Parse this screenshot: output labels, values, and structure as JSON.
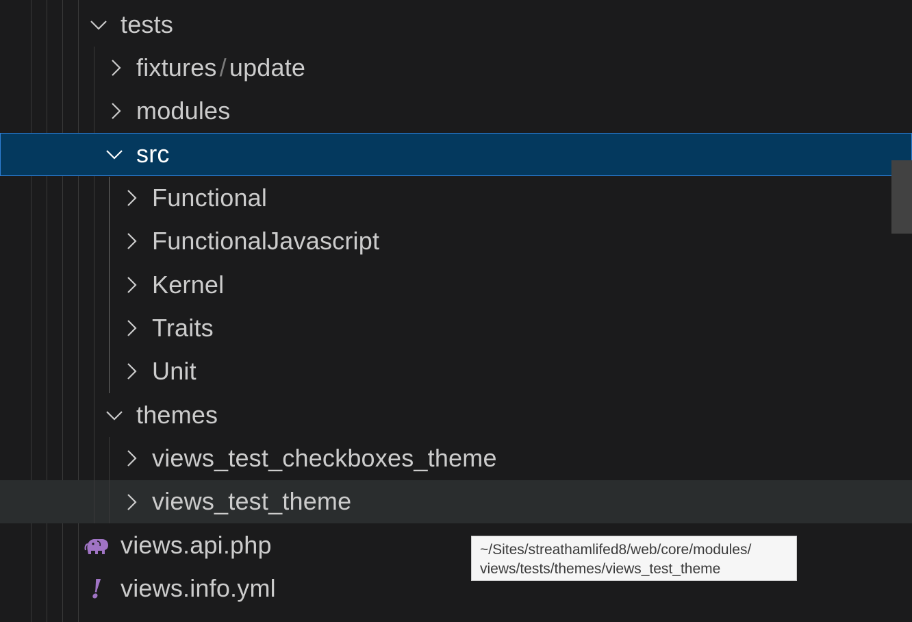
{
  "explorer": {
    "rows": [
      {
        "label": "tests",
        "expanded": true
      },
      {
        "label_parts": [
          "fixtures",
          "/",
          "update"
        ],
        "expanded": false
      },
      {
        "label": "modules",
        "expanded": false
      },
      {
        "label": "src",
        "expanded": true,
        "selected": true
      },
      {
        "label": "Functional",
        "expanded": false
      },
      {
        "label": "FunctionalJavascript",
        "expanded": false
      },
      {
        "label": "Kernel",
        "expanded": false
      },
      {
        "label": "Traits",
        "expanded": false
      },
      {
        "label": "Unit",
        "expanded": false
      },
      {
        "label": "themes",
        "expanded": true
      },
      {
        "label": "views_test_checkboxes_theme",
        "expanded": false
      },
      {
        "label": "views_test_theme",
        "expanded": false,
        "hovered": true
      },
      {
        "label": "views.api.php",
        "icon": "php-elephant-icon"
      },
      {
        "label": "views.info.yml",
        "icon": "yaml-exclamation-icon"
      }
    ]
  },
  "tooltip": {
    "line1": "~/Sites/streathamlifed8/web/core/modules/",
    "line2": "views/tests/themes/views_test_theme"
  },
  "colors": {
    "background": "#1b1b1c",
    "selection_bg": "#04395e",
    "selection_border": "#2f7fd6",
    "hover_bg": "#2a2d2e",
    "text": "#cccccc",
    "php_icon": "#a074c4",
    "yaml_icon": "#a074c4",
    "tooltip_bg": "#f6f6f6"
  },
  "icons": {
    "collapsed": "chevron-right-icon",
    "expanded": "chevron-down-icon"
  }
}
